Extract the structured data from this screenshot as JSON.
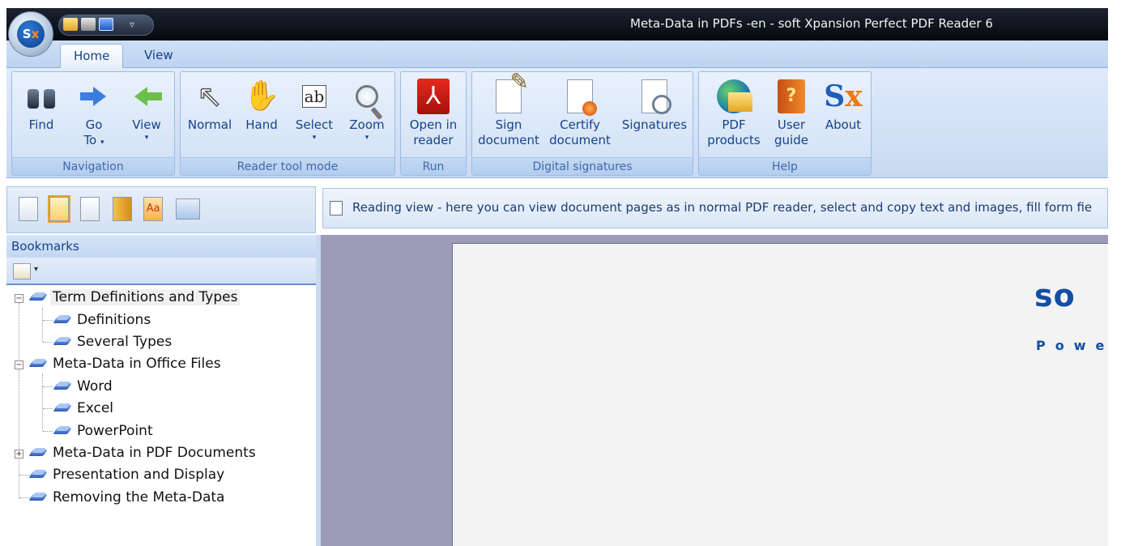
{
  "window": {
    "title": "Meta-Data in PDFs -en - soft Xpansion Perfect PDF Reader 6"
  },
  "tabs": [
    {
      "label": "Home",
      "active": true
    },
    {
      "label": "View",
      "active": false
    }
  ],
  "ribbon": {
    "navigation": {
      "label": "Navigation",
      "find": "Find",
      "goto_line1": "Go",
      "goto_line2": "To",
      "view": "View"
    },
    "reader_tool_mode": {
      "label": "Reader tool mode",
      "normal": "Normal",
      "hand": "Hand",
      "select": "Select",
      "select_icon_text": "ab",
      "zoom": "Zoom"
    },
    "run": {
      "label": "Run",
      "open_line1": "Open in",
      "open_line2": "reader"
    },
    "digital_signatures": {
      "label": "Digital signatures",
      "sign_line1": "Sign",
      "sign_line2": "document",
      "certify_line1": "Certify",
      "certify_line2": "document",
      "signatures": "Signatures"
    },
    "help": {
      "label": "Help",
      "pdf_line1": "PDF",
      "pdf_line2": "products",
      "guide_line1": "User",
      "guide_line2": "guide",
      "about": "About"
    }
  },
  "infobar": {
    "text": "Reading view - here you can view document pages as in normal PDF reader, select and copy text and images, fill form fie"
  },
  "bookmarks": {
    "header": "Bookmarks",
    "items": [
      {
        "label": "Term Definitions and Types",
        "level": 0,
        "expander": "−"
      },
      {
        "label": "Definitions",
        "level": 1
      },
      {
        "label": "Several Types",
        "level": 1
      },
      {
        "label": "Meta-Data in Office Files",
        "level": 0,
        "expander": "−"
      },
      {
        "label": "Word",
        "level": 1
      },
      {
        "label": "Excel",
        "level": 1
      },
      {
        "label": "PowerPoint",
        "level": 1
      },
      {
        "label": "Meta-Data in PDF Documents",
        "level": 0,
        "expander": "+"
      },
      {
        "label": "Presentation and Display",
        "level": 0
      },
      {
        "label": "Removing the Meta-Data",
        "level": 0
      }
    ]
  },
  "document": {
    "brand_text": "so",
    "tagline": "Powe"
  },
  "colors": {
    "ribbon_text": "#15428b",
    "doc_background": "#9c9cb8",
    "brand_blue": "#124ea3"
  }
}
